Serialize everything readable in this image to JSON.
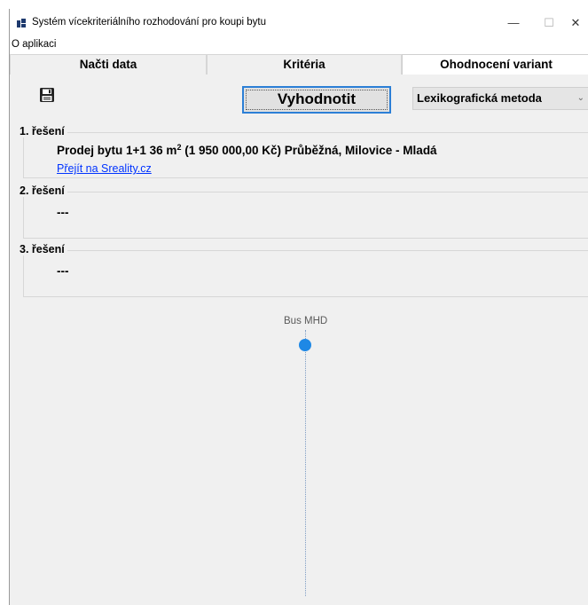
{
  "window": {
    "title": "Systém vícekriteriálního rozhodování pro koupi bytu",
    "minimize_glyph": "—",
    "maximize_glyph": "☐",
    "close_glyph": "✕"
  },
  "menu": {
    "items": [
      "O aplikaci"
    ]
  },
  "tabs": [
    {
      "label": "Načti data",
      "active": false
    },
    {
      "label": "Kritéria",
      "active": false
    },
    {
      "label": "Ohodnocení variant",
      "active": true
    }
  ],
  "toolbar": {
    "save_icon": "floppy-disk-icon",
    "evaluate_label": "Vyhodnotit",
    "method_selected": "Lexikografická metoda"
  },
  "results": [
    {
      "title": "1. řešení",
      "text_before_sup": "Prodej bytu 1+1 36 m",
      "sup": "2",
      "text_after_sup": " (1 950 000,00 Kč) Průběžná, Milovice - Mladá",
      "link": "Přejít na Sreality.cz"
    },
    {
      "title": "2. řešení",
      "text": "---"
    },
    {
      "title": "3. řešení",
      "text": "---"
    }
  ],
  "slider": {
    "label": "Bus MHD",
    "value_fraction": 0.0
  },
  "colors": {
    "accent": "#1e88e5",
    "link": "#0033ff",
    "button_focus": "#2c7fd6"
  }
}
